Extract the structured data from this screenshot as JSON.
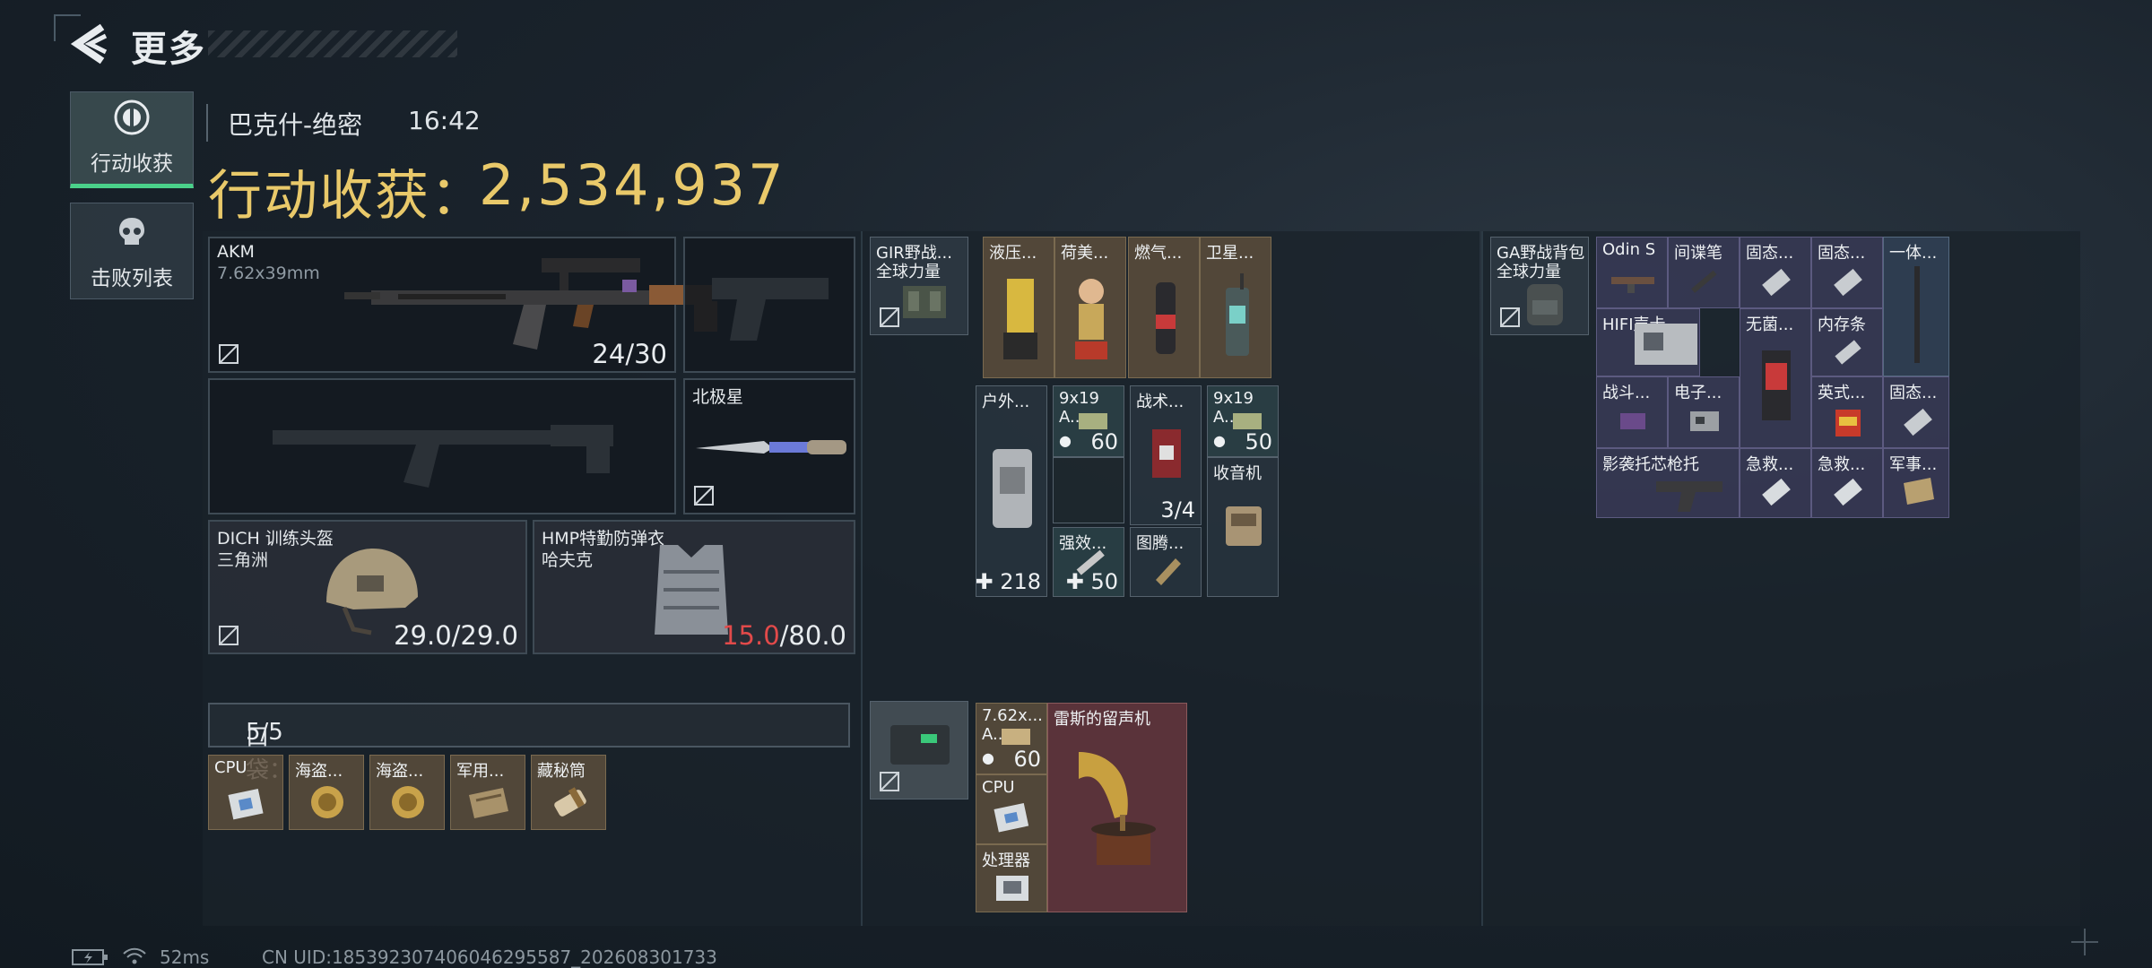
{
  "header": {
    "title": "更多"
  },
  "side_tabs": [
    {
      "label": "行动收获",
      "active": true,
      "icon": "target-eye-icon"
    },
    {
      "label": "击败列表",
      "active": false,
      "icon": "skull-icon"
    }
  ],
  "match": {
    "map": "巴克什-绝密",
    "time": "16:42",
    "loot_label": "行动收获：",
    "loot_value": "2,534,937"
  },
  "equipment": {
    "primary": {
      "name": "AKM",
      "ammo_type": "7.62x39mm",
      "ammo": "24/30"
    },
    "knife": {
      "name": "北极星"
    },
    "helmet": {
      "name": "DICH 训练头盔",
      "sub": "三角洲",
      "durability": "29.0/29.0"
    },
    "armor": {
      "name": "HMP特勤防弹衣",
      "sub": "哈夫克",
      "durability_current": "15.0",
      "durability_max": "/80.0"
    }
  },
  "pocket": {
    "label": "口袋：",
    "count": "5/5",
    "items": [
      "CPU",
      "海盗...",
      "海盗...",
      "军用...",
      "藏秘筒"
    ]
  },
  "chest_rig": {
    "name": "GIR野战...",
    "sub": "全球力量",
    "items": [
      {
        "name": "液压..."
      },
      {
        "name": "荷美..."
      },
      {
        "name": "燃气..."
      },
      {
        "name": "卫星..."
      },
      {
        "name": "户外...",
        "count": "218"
      },
      {
        "name": "9x19",
        "sub": "A...",
        "count": "60"
      },
      {
        "name": "强效...",
        "count": "50"
      },
      {
        "name": "战术...",
        "count": "3/4"
      },
      {
        "name": "图腾..."
      },
      {
        "name": "9x19",
        "sub": "A...",
        "count": "50"
      },
      {
        "name": "收音机"
      }
    ]
  },
  "safebox": {
    "items": [
      {
        "name": "7.62x...",
        "sub": "A...",
        "count": "60"
      },
      {
        "name": "CPU"
      },
      {
        "name": "处理器"
      },
      {
        "name": "雷斯的留声机"
      }
    ]
  },
  "backpack": {
    "name": "GA野战背包",
    "sub": "全球力量",
    "items": [
      {
        "name": "Odin S"
      },
      {
        "name": "间谍笔"
      },
      {
        "name": "固态..."
      },
      {
        "name": "固态..."
      },
      {
        "name": "一体..."
      },
      {
        "name": "HIFI声卡"
      },
      {
        "name": "无菌..."
      },
      {
        "name": "内存条"
      },
      {
        "name": "战斗..."
      },
      {
        "name": "电子..."
      },
      {
        "name": "英式..."
      },
      {
        "name": "固态..."
      },
      {
        "name": "影袭托芯枪托"
      },
      {
        "name": "急救..."
      },
      {
        "name": "急救..."
      },
      {
        "name": "军事..."
      }
    ]
  },
  "status": {
    "ping": "52ms",
    "uid": "CN UID:185392307406046295587_202608301733"
  },
  "colors": {
    "gold": "#e9c96a",
    "accent_green": "#4ad18a",
    "danger": "#e24a4a"
  }
}
